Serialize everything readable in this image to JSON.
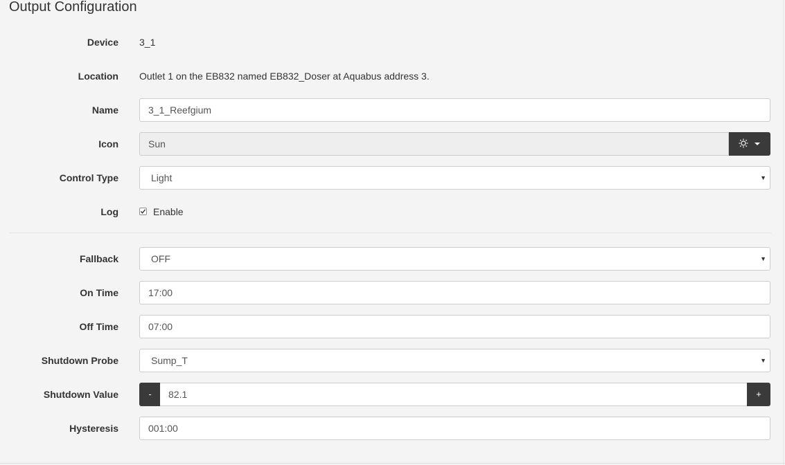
{
  "page": {
    "title": "Output Configuration"
  },
  "form": {
    "device": {
      "label": "Device",
      "value": "3_1"
    },
    "location": {
      "label": "Location",
      "value": "Outlet 1 on the EB832 named EB832_Doser at Aquabus address 3."
    },
    "name": {
      "label": "Name",
      "value": "3_1_Reefgium"
    },
    "icon": {
      "label": "Icon",
      "value": "Sun",
      "button_icon": "sun-icon"
    },
    "control_type": {
      "label": "Control Type",
      "value": "Light"
    },
    "log": {
      "label": "Log",
      "checkbox_label": "Enable",
      "checked": true
    },
    "fallback": {
      "label": "Fallback",
      "value": "OFF"
    },
    "on_time": {
      "label": "On Time",
      "value": "17:00"
    },
    "off_time": {
      "label": "Off Time",
      "value": "07:00"
    },
    "shutdown_probe": {
      "label": "Shutdown Probe",
      "value": "Sump_T"
    },
    "shutdown_value": {
      "label": "Shutdown Value",
      "value": "82.1",
      "minus_label": "-",
      "plus_label": "+"
    },
    "hysteresis": {
      "label": "Hysteresis",
      "value": "001:00"
    }
  },
  "colors": {
    "background": "#f4f4f4",
    "button_dark": "#3a3a3a",
    "input_border": "#cccccc",
    "readonly_bg": "#eeeeee"
  }
}
